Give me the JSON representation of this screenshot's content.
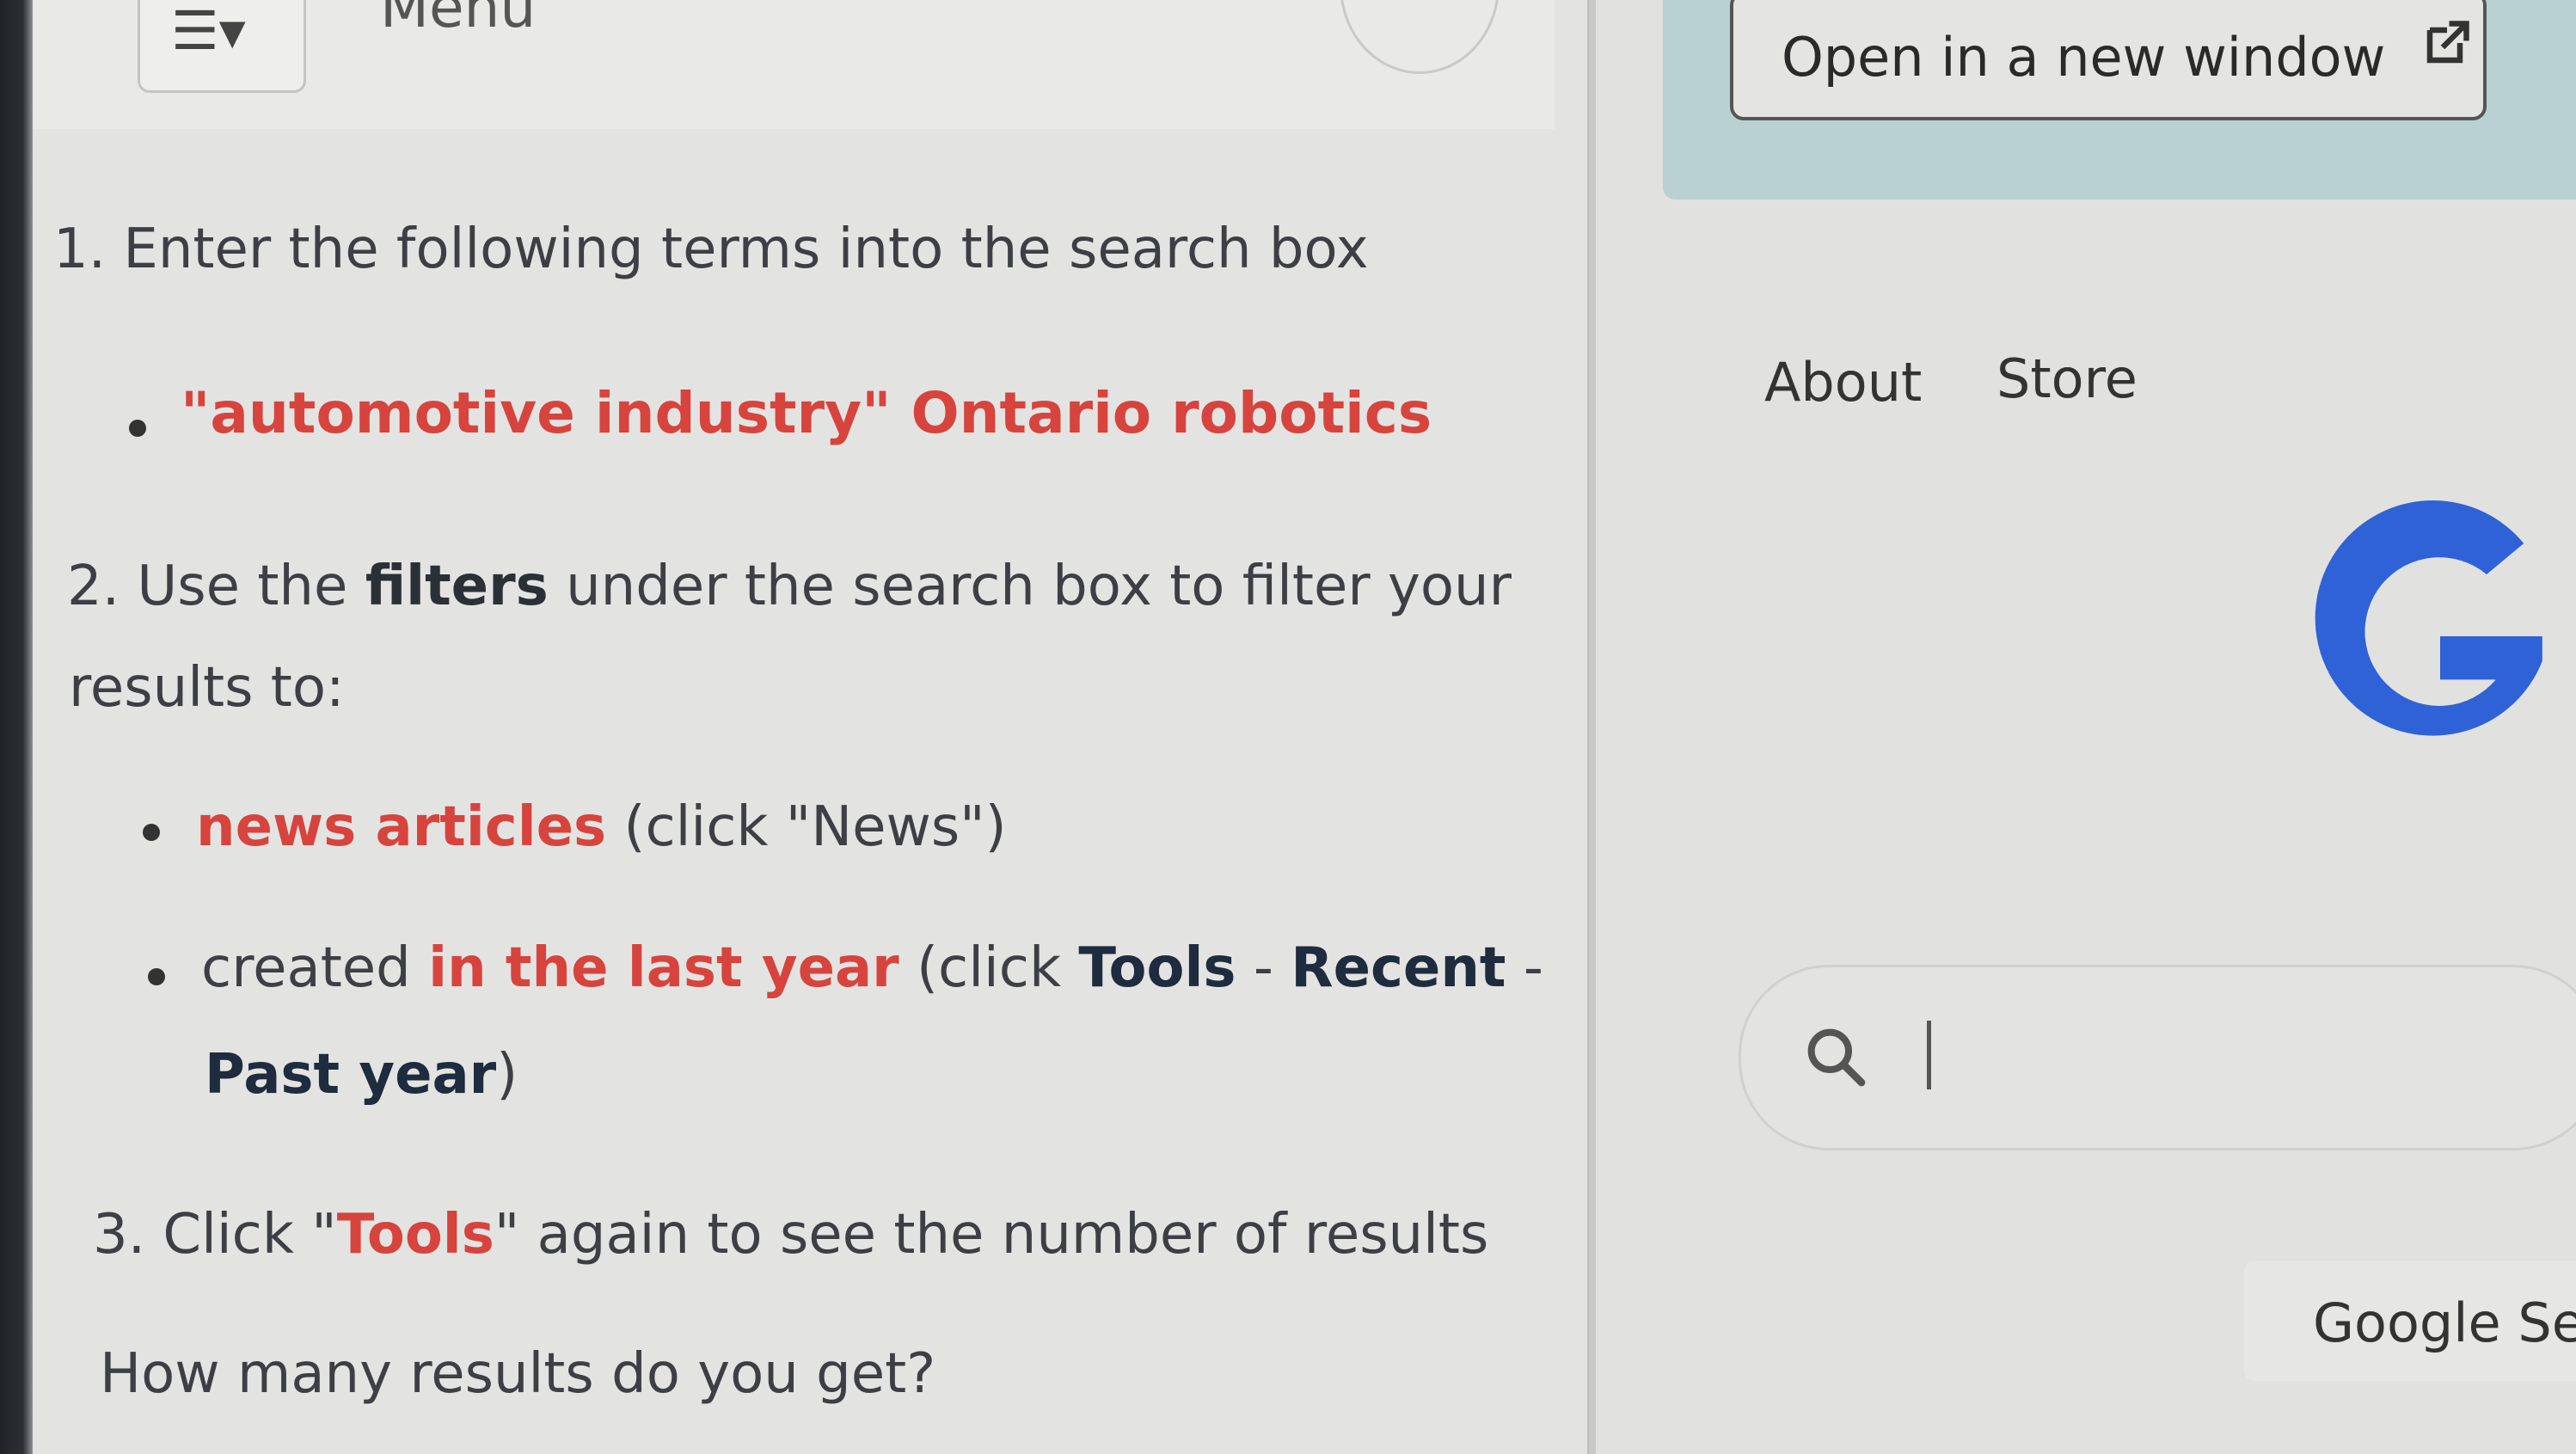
{
  "menu": {
    "icon": "hamburger-dropdown-icon",
    "label": "Menu"
  },
  "open_window": {
    "label": "Open in a new window",
    "icon": "external-link-icon"
  },
  "instructions": {
    "step1": "1. Enter the following terms into the search box",
    "step1_term": "\"automotive industry\" Ontario robotics",
    "step2_a": "2. Use the ",
    "step2_b": "filters",
    "step2_c": " under the search box to filter your",
    "step2_d": "results to:",
    "bullet1_a": "news articles",
    "bullet1_b": " (click \"News\")",
    "bullet2_a": "created ",
    "bullet2_b": "in the last year",
    "bullet2_c": " (click ",
    "bullet2_d": "Tools",
    "bullet2_e": " - ",
    "bullet2_f": "Recent",
    "bullet2_g": " -",
    "bullet2_h": "Past year",
    "bullet2_i": ")",
    "step3_a": "3. Click \"",
    "step3_b": "Tools",
    "step3_c": "\" again to see the number of results",
    "question": "How many results do you get?"
  },
  "google": {
    "nav": [
      "About",
      "Store"
    ],
    "logo_letter": "G",
    "search_button": "Google Se"
  },
  "colors": {
    "accent_red": "#d7443d",
    "google_blue": "#2f62d6",
    "dark_bold": "#1f2b3e"
  }
}
